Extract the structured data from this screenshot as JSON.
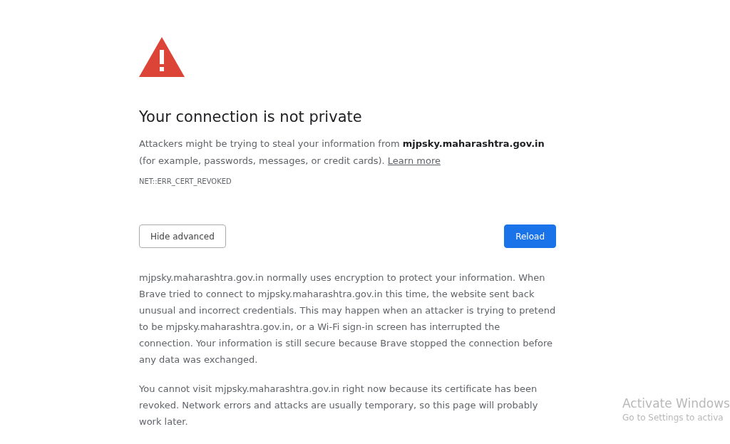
{
  "heading": "Your connection is not private",
  "intro": {
    "text": "Attackers might be trying to steal your information from **mjpsky.maharashtra.gov.in** (for example, passwords, messages, or credit cards).",
    "link": "Learn more"
  },
  "error_code": "NET::ERR_CERT_REVOKED",
  "buttons": [
    {
      "label": "Hide advanced",
      "kind": "secondary"
    },
    {
      "label": "Reload",
      "kind": "primary"
    }
  ],
  "details": [
    "mjpsky.maharashtra.gov.in normally uses encryption to protect your information. When Brave tried to connect to mjpsky.maharashtra.gov.in this time, the website sent back unusual and incorrect credentials. This may happen when an attacker is trying to pretend to be mjpsky.maharashtra.gov.in, or a Wi-Fi sign-in screen has interrupted the connection. Your information is still secure because Brave stopped the connection before any data was exchanged.",
    "You cannot visit mjpsky.maharashtra.gov.in right now because its certificate has been revoked. Network errors and attacks are usually temporary, so this page will probably work later."
  ],
  "activation_notice": {
    "title": "Activate Windows",
    "subtitle": "Go to Settings to activa"
  }
}
